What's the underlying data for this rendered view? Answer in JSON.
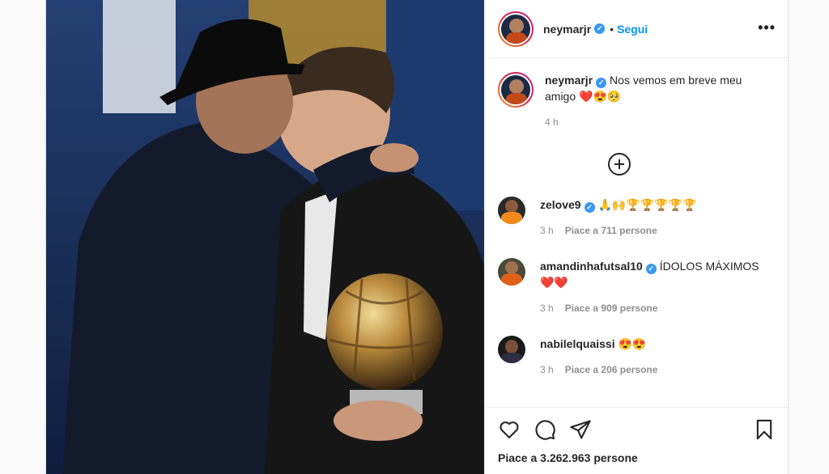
{
  "post": {
    "author": "neymarjr",
    "follow_label": "Segui",
    "separator": "•",
    "more_label": "•••"
  },
  "caption": {
    "username": "neymarjr",
    "text": "Nos vemos em breve meu amigo ❤️😍🥺",
    "time": "4 h"
  },
  "comments": [
    {
      "username": "zelove9",
      "verified": true,
      "text": "🙏🙌🏆🏆🏆🏆🏆",
      "time": "3 h",
      "likes": "Piace a 711 persone"
    },
    {
      "username": "amandinhafutsal10",
      "verified": true,
      "text": "ÍDOLOS MÁXIMOS ❤️❤️",
      "time": "3 h",
      "likes": "Piace a 909 persone"
    },
    {
      "username": "nabilelquaissi",
      "verified": false,
      "text": "😍😍",
      "time": "3 h",
      "likes": "Piace a 206 persone"
    }
  ],
  "footer": {
    "likes_total": "Piace a 3.262.963 persone"
  },
  "icons": {
    "more": "plus-circle-icon",
    "like": "heart-icon",
    "comment": "comment-icon",
    "share": "paper-plane-icon",
    "save": "bookmark-icon",
    "verified": "verified-badge-icon"
  },
  "colors": {
    "link": "#0095f6",
    "verified": "#3897f0",
    "muted": "#8e8e8e"
  }
}
